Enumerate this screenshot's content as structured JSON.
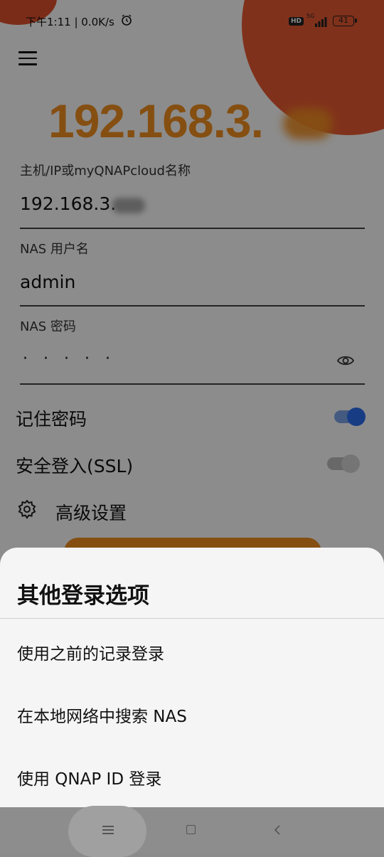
{
  "status_bar": {
    "time_speed": "下午1:11 | 0.0K/s",
    "hd_label": "HD",
    "network_type": "5G",
    "battery": "41",
    "icons": [
      "alarm-icon",
      "signal-icon",
      "battery-icon"
    ]
  },
  "header": {
    "menu_icon": "hamburger-menu-icon",
    "host_display": "192.168.3."
  },
  "form": {
    "host": {
      "label": "主机/IP或myQNAPcloud名称",
      "value": "192.168.3."
    },
    "username": {
      "label": "NAS 用户名",
      "value": "admin"
    },
    "password": {
      "label": "NAS 密码",
      "masked_value": "·····",
      "toggle_icon": "eye-icon"
    },
    "remember_password": {
      "label": "记住密码",
      "checked": true
    },
    "secure_login": {
      "label": "安全登入(SSL)",
      "checked": false
    },
    "advanced": {
      "label": "高级设置",
      "icon": "gear-icon"
    }
  },
  "colors": {
    "accent_orange": "#f39022",
    "toggle_on": "#2c6df0",
    "blob_red": "#ea5a32"
  },
  "bottom_sheet": {
    "title": "其他登录选项",
    "options": [
      {
        "label": "使用之前的记录登录"
      },
      {
        "label": "在本地网络中搜索 NAS"
      },
      {
        "label": "使用 QNAP ID 登录"
      }
    ]
  },
  "nav_bar": {
    "icons": [
      "menu-icon",
      "home-icon",
      "back-icon"
    ]
  }
}
